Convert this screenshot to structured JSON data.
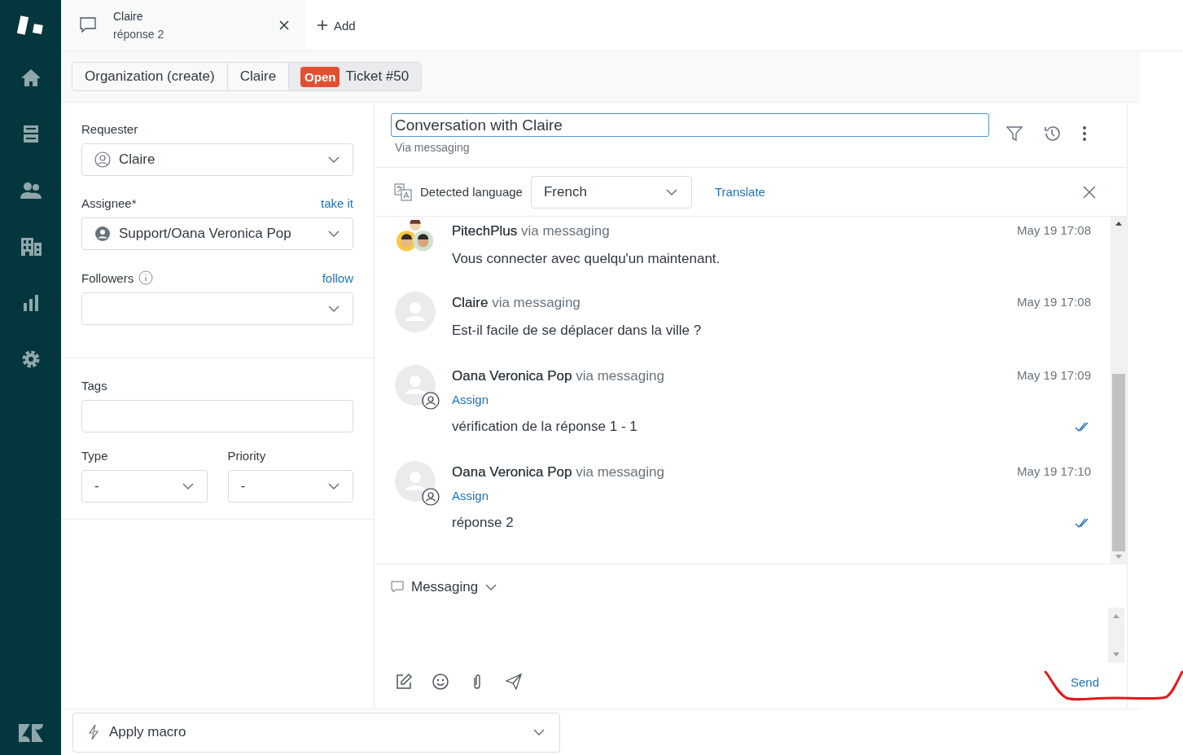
{
  "tab": {
    "title": "Claire",
    "subtitle": "réponse 2",
    "add_label": "Add"
  },
  "breadcrumbs": [
    {
      "kind": "text",
      "label": "Organization (create)"
    },
    {
      "kind": "text",
      "label": "Claire"
    },
    {
      "kind": "ticket",
      "status": "Open",
      "label": "Ticket #50"
    }
  ],
  "fields": {
    "requester": {
      "label": "Requester",
      "value": "Claire"
    },
    "assignee": {
      "label": "Assignee*",
      "value": "Support/Oana Veronica Pop",
      "action": "take it"
    },
    "followers": {
      "label": "Followers",
      "action": "follow"
    },
    "tags": {
      "label": "Tags"
    },
    "type": {
      "label": "Type",
      "value": "-"
    },
    "priority": {
      "label": "Priority",
      "value": "-"
    }
  },
  "conversation": {
    "subject": "Conversation with Claire",
    "channel": "Via messaging",
    "language_label": "Detected language",
    "language": "French",
    "translate": "Translate",
    "messages": [
      {
        "kind": "group",
        "author": "PitechPlus",
        "via": "via messaging",
        "time": "May 19 17:08",
        "body": "Vous connecter avec quelqu'un maintenant.",
        "read": false
      },
      {
        "kind": "person",
        "author": "Claire",
        "via": "via messaging",
        "time": "May 19 17:08",
        "body": "Est-il facile de se déplacer dans la ville ?",
        "read": false
      },
      {
        "kind": "agent",
        "author": "Oana Veronica Pop",
        "via": "via messaging",
        "time": "May 19 17:09",
        "assign": "Assign",
        "body": "vérification de la réponse 1 - 1",
        "read": true
      },
      {
        "kind": "agent",
        "author": "Oana Veronica Pop",
        "via": "via messaging",
        "time": "May 19 17:10",
        "assign": "Assign",
        "body": "réponse 2",
        "read": true
      }
    ]
  },
  "composer": {
    "channel": "Messaging",
    "send": "Send"
  },
  "macro": {
    "placeholder": "Apply macro"
  }
}
